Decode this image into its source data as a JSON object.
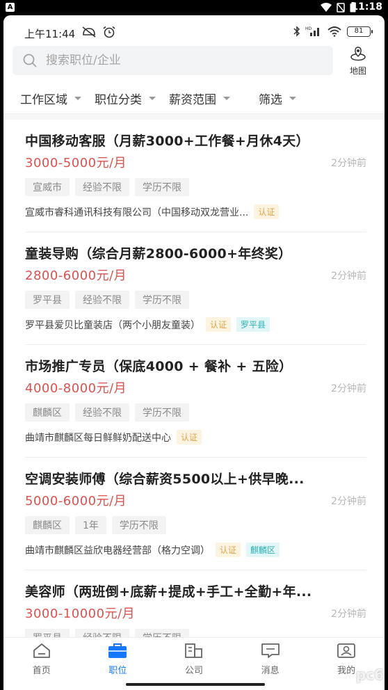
{
  "system": {
    "time": "11:18",
    "indicator": "A"
  },
  "status": {
    "time": "上午11:44",
    "battery": "81"
  },
  "search": {
    "placeholder": "搜索职位/企业"
  },
  "map": {
    "label": "地图"
  },
  "filters": [
    {
      "label": "工作区域"
    },
    {
      "label": "职位分类"
    },
    {
      "label": "薪资范围"
    },
    {
      "label": "筛选"
    }
  ],
  "jobs": [
    {
      "title": "中国移动客服（月薪3000+工作餐+月休4天）",
      "salary": "3000-5000元/月",
      "time": "2分钟前",
      "tags": [
        "宣威市",
        "经验不限",
        "学历不限"
      ],
      "company": "宣威市睿科通讯科技有限公司（中国移动双龙营业...",
      "verify": "认证",
      "area": ""
    },
    {
      "title": "童装导购（综合月薪2800-6000+年终奖）",
      "salary": "2800-6000元/月",
      "time": "2分钟前",
      "tags": [
        "罗平县",
        "经验不限",
        "学历不限"
      ],
      "company": "罗平县爱贝比童装店（两个小朋友童装）",
      "verify": "认证",
      "area": "罗平县"
    },
    {
      "title": "市场推广专员（保底4000 + 餐补 + 五险）",
      "salary": "4000-8000元/月",
      "time": "2分钟前",
      "tags": [
        "麒麟区",
        "经验不限",
        "学历不限"
      ],
      "company": "曲靖市麒麟区每日鲜鲜奶配送中心",
      "verify": "认证",
      "area": ""
    },
    {
      "title": "空调安装师傅（综合薪资5500以上+供早晚...",
      "salary": "5000-6000元/月",
      "time": "2分钟前",
      "tags": [
        "麒麟区",
        "1年",
        "学历不限"
      ],
      "company": "曲靖市麒麟区益欣电器经营部（格力空调）",
      "verify": "认证",
      "area": "麒麟区"
    },
    {
      "title": "美容师（两班倒+底薪+提成+手工+全勤+年...",
      "salary": "3000-10000元/月",
      "time": "2分钟前",
      "tags": [
        "罗平县",
        "经验不限",
        "学历不限"
      ],
      "company": "",
      "verify": "",
      "area": ""
    }
  ],
  "tabs": [
    {
      "label": "首页"
    },
    {
      "label": "职位"
    },
    {
      "label": "公司"
    },
    {
      "label": "消息"
    },
    {
      "label": "我的"
    }
  ],
  "watermark": "pc6",
  "colors": {
    "accent": "#1677ff",
    "salary": "#d9534f",
    "verify": "#e2a34a",
    "area": "#2ab3b7"
  }
}
